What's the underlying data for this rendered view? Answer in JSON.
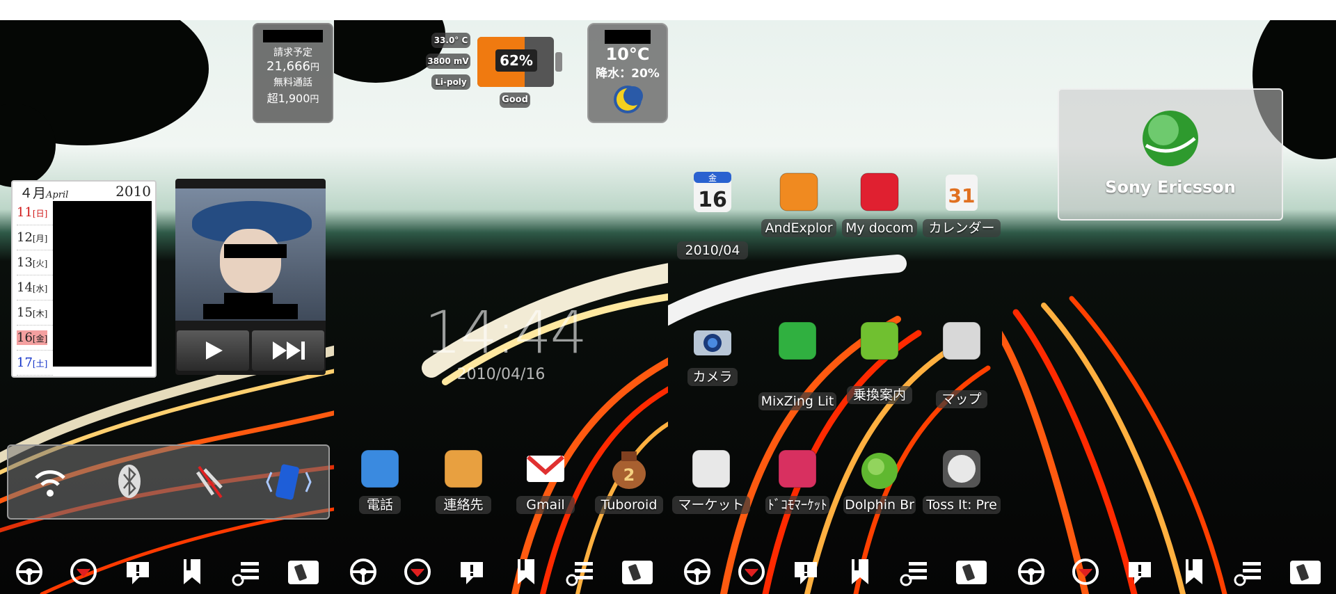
{
  "screens": [
    {
      "id": "screen-1",
      "billing": {
        "line1": "請求予定",
        "amount": "21,666",
        "amount_unit": "円",
        "line3": "無料通話",
        "free": "超1,900",
        "free_unit": "円"
      },
      "calendar": {
        "month": "４月",
        "month_en": "April",
        "year": "2010",
        "days": [
          {
            "d": "11",
            "w": "[日]",
            "color": "#d01818"
          },
          {
            "d": "12",
            "w": "[月]",
            "color": "#222"
          },
          {
            "d": "13",
            "w": "[火]",
            "color": "#222"
          },
          {
            "d": "14",
            "w": "[水]",
            "color": "#222"
          },
          {
            "d": "15",
            "w": "[木]",
            "color": "#222"
          },
          {
            "d": "16",
            "w": "[金]",
            "color": "#222",
            "today": true
          },
          {
            "d": "17",
            "w": "[土]",
            "color": "#1030c8"
          }
        ]
      },
      "music": {
        "play_icon": "play-icon",
        "next_icon": "skip-next-icon"
      },
      "toggles": [
        "wifi-icon",
        "bluetooth-icon",
        "gps-off-icon",
        "sync-icon"
      ]
    },
    {
      "id": "screen-2",
      "battery": {
        "temp": "33.0° C",
        "voltage": "3800 mV",
        "type": "Li-poly",
        "percent": "62%",
        "health": "Good",
        "level": 0.62
      },
      "weather": {
        "temp": "10°C",
        "precip": "降水：20%"
      },
      "clock": {
        "time": "14:44",
        "date": "2010/04/16"
      },
      "apps": [
        {
          "label": "電話",
          "icon": "phone-icon"
        },
        {
          "label": "連絡先",
          "icon": "contacts-icon"
        },
        {
          "label": "Gmail",
          "icon": "gmail-icon"
        },
        {
          "label": "Tuboroid",
          "icon": "tuboroid-icon"
        }
      ]
    },
    {
      "id": "screen-3",
      "apps": [
        {
          "label": "2010/04",
          "icon": "calendar-date-icon",
          "badge_day": "金",
          "badge_num": "16"
        },
        {
          "label": "AndExplor",
          "icon": "andexplorer-icon"
        },
        {
          "label": "My docom",
          "icon": "mydocomo-icon"
        },
        {
          "label": "カレンダー",
          "icon": "calendar-icon",
          "badge_num": "31"
        },
        {
          "label": "カメラ",
          "icon": "camera-icon"
        },
        {
          "label": "MixZing Lit",
          "icon": "mixzing-icon"
        },
        {
          "label": "乗換案内",
          "icon": "transit-icon"
        },
        {
          "label": "マップ",
          "icon": "maps-icon"
        },
        {
          "label": "マーケット",
          "icon": "market-icon"
        },
        {
          "label": "ﾄﾞｺﾓﾏｰｹｯﾄ",
          "icon": "docomo-market-icon"
        },
        {
          "label": "Dolphin Br",
          "icon": "dolphin-browser-icon"
        },
        {
          "label": "Toss It: Pre",
          "icon": "tossit-icon"
        }
      ]
    },
    {
      "id": "screen-4",
      "logo": {
        "text": "Sony Ericsson"
      }
    }
  ],
  "dock": [
    "steering-icon",
    "chevron-down-circle-icon",
    "alert-bubble-icon",
    "bookmark-icon",
    "list-settings-icon",
    "rotate-phone-icon"
  ],
  "colors": {
    "accent_orange": "#f07a10",
    "pill_bg": "#3c3c3c"
  }
}
